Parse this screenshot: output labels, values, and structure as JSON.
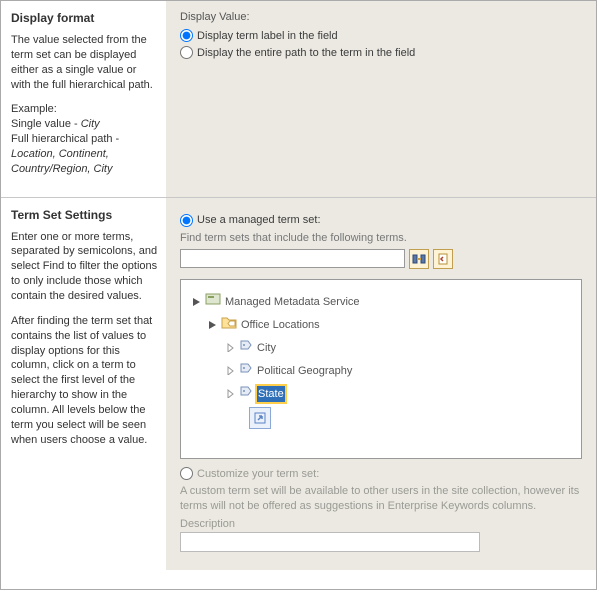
{
  "displayFormat": {
    "title": "Display format",
    "desc1": "The value selected from the term set can be displayed either as a single value or with the full hierarchical path.",
    "desc2_label": "Example:",
    "desc2_single_prefix": "Single value - ",
    "desc2_single_value": "City",
    "desc2_full_prefix": "Full hierarchical path - ",
    "desc2_full_value": "Location, Continent, Country/Region, City",
    "groupLabel": "Display Value:",
    "opt1": "Display term label in the field",
    "opt2": "Display the entire path to the term in the field"
  },
  "termSet": {
    "title": "Term Set Settings",
    "desc1": "Enter one or more terms, separated by semicolons, and select Find to filter the options to only include those which contain the desired values.",
    "desc2": "After finding the term set that contains the list of values to display options for this column, click on a term to select the first level of the hierarchy to show in the column. All levels below the term you select will be seen when users choose a value.",
    "managedLabel": "Use a managed term set:",
    "findLabel": "Find term sets that include the following terms.",
    "searchValue": "",
    "tree": {
      "root": "Managed Metadata Service",
      "child1": "Office Locations",
      "leaf1": "City",
      "leaf2": "Political Geography",
      "leaf3": "State"
    },
    "customLabel": "Customize your term set:",
    "customDesc": "A custom term set will be available to other users in the site collection, however its terms will not be offered as suggestions in Enterprise Keywords columns.",
    "descLabel": "Description",
    "descValue": ""
  }
}
